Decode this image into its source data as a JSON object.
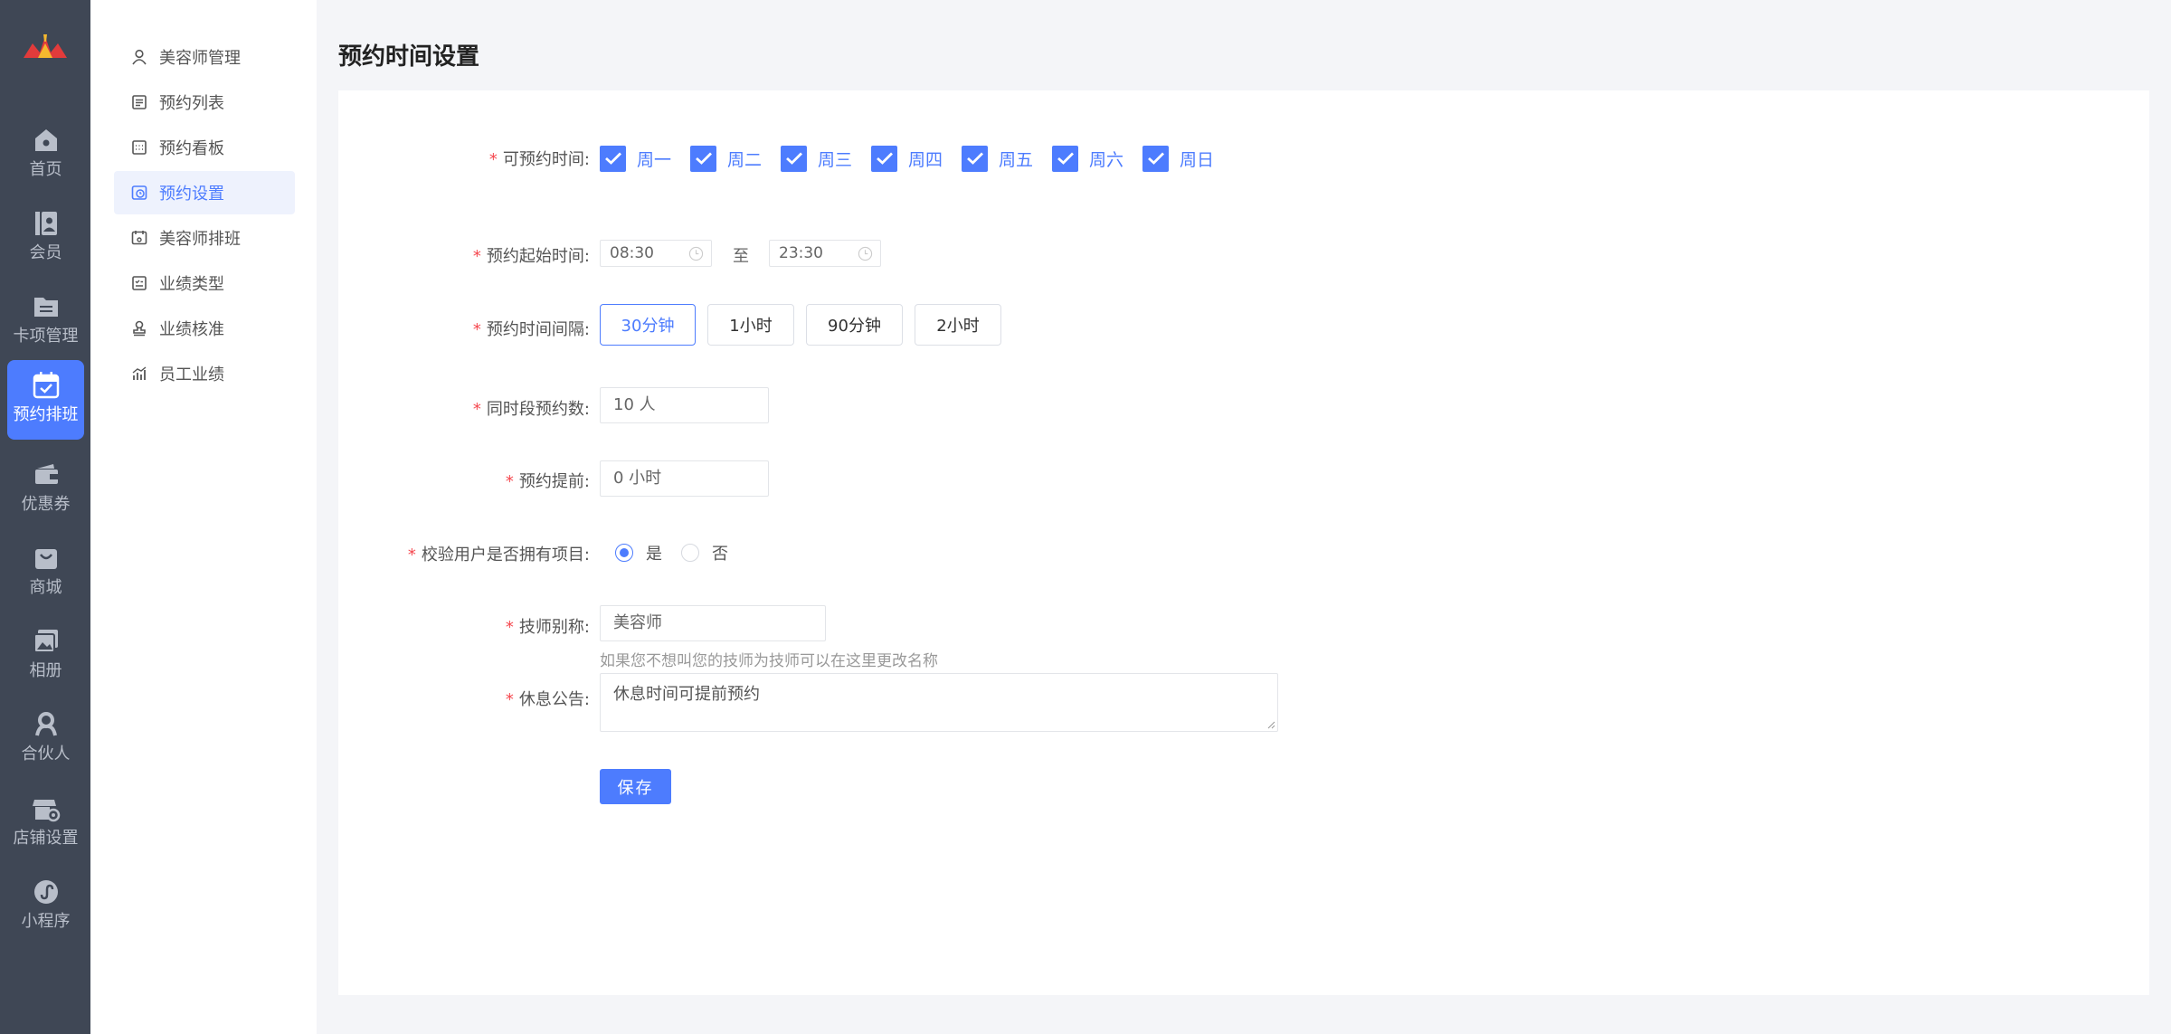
{
  "colors": {
    "accent": "#4d7cfe",
    "rail_bg": "#3f4755",
    "required": "#f5484f"
  },
  "rail": {
    "items": [
      {
        "label": "首页",
        "icon": "home-icon"
      },
      {
        "label": "会员",
        "icon": "member-card-icon"
      },
      {
        "label": "卡项管理",
        "icon": "folder-icon"
      },
      {
        "label": "预约排班",
        "icon": "calendar-check-icon",
        "active": true
      },
      {
        "label": "优惠券",
        "icon": "wallet-icon"
      },
      {
        "label": "商城",
        "icon": "shopping-bag-icon"
      },
      {
        "label": "相册",
        "icon": "album-icon"
      },
      {
        "label": "合伙人",
        "icon": "partner-icon"
      },
      {
        "label": "店铺设置",
        "icon": "store-settings-icon"
      },
      {
        "label": "小程序",
        "icon": "mini-program-icon"
      }
    ]
  },
  "submenu": {
    "items": [
      {
        "label": "美容师管理",
        "icon": "user-icon"
      },
      {
        "label": "预约列表",
        "icon": "list-icon"
      },
      {
        "label": "预约看板",
        "icon": "board-icon"
      },
      {
        "label": "预约设置",
        "icon": "clock-settings-icon",
        "active": true
      },
      {
        "label": "美容师排班",
        "icon": "schedule-icon"
      },
      {
        "label": "业绩类型",
        "icon": "type-list-icon"
      },
      {
        "label": "业绩核准",
        "icon": "stamp-icon"
      },
      {
        "label": "员工业绩",
        "icon": "bar-chart-icon"
      }
    ]
  },
  "page": {
    "title": "预约时间设置"
  },
  "form": {
    "days_label": "可预约时间:",
    "days": [
      "周一",
      "周二",
      "周三",
      "周四",
      "周五",
      "周六",
      "周日"
    ],
    "start_label": "预约起始时间:",
    "start_time": "08:30",
    "to_sep": "至",
    "end_time": "23:30",
    "interval_label": "预约时间间隔:",
    "intervals": [
      "30分钟",
      "1小时",
      "90分钟",
      "2小时"
    ],
    "interval_selected": "30分钟",
    "concurrent_label": "同时段预约数:",
    "concurrent_value": "10 人",
    "advance_label": "预约提前:",
    "advance_value": "0 小时",
    "verify_label": "校验用户是否拥有项目:",
    "verify_yes": "是",
    "verify_no": "否",
    "verify_selected": "是",
    "alias_label": "技师别称:",
    "alias_value": "美容师",
    "alias_hint": "如果您不想叫您的技师为技师可以在这里更改名称",
    "notice_label": "休息公告:",
    "notice_value": "休息时间可提前预约",
    "required_mark": "*",
    "save_label": "保存"
  }
}
